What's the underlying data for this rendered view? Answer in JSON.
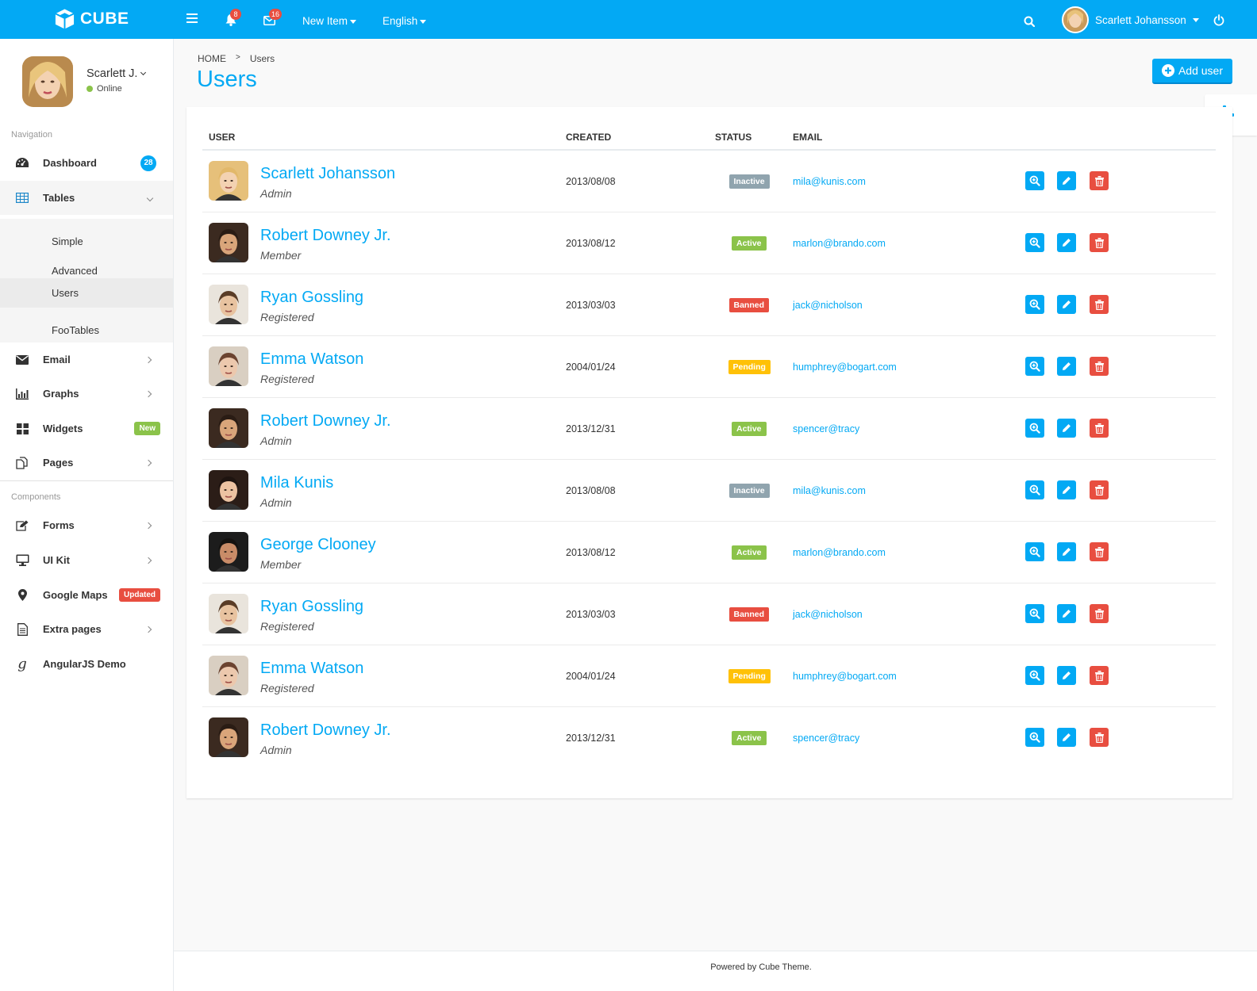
{
  "brand": "CUBE",
  "topbar": {
    "notifications_count": "8",
    "messages_count": "16",
    "new_item": "New Item",
    "language": "English",
    "user_name": "Scarlett Johansson"
  },
  "profile": {
    "name": "Scarlett J.",
    "status": "Online"
  },
  "nav": {
    "heading": "Navigation",
    "dashboard": {
      "label": "Dashboard",
      "badge": "28"
    },
    "tables": {
      "label": "Tables"
    },
    "submenu": [
      "Simple",
      "Advanced",
      "Users",
      "FooTables"
    ],
    "email": {
      "label": "Email"
    },
    "graphs": {
      "label": "Graphs"
    },
    "widgets": {
      "label": "Widgets",
      "badge": "New"
    },
    "pages": {
      "label": "Pages"
    },
    "components_heading": "Components",
    "forms": {
      "label": "Forms"
    },
    "uikit": {
      "label": "UI Kit"
    },
    "maps": {
      "label": "Google Maps",
      "badge": "Updated"
    },
    "extra": {
      "label": "Extra pages"
    },
    "angular": {
      "label": "AngularJS Demo"
    }
  },
  "breadcrumb": {
    "home": "HOME",
    "current": "Users"
  },
  "page_title": "Users",
  "add_user_label": "Add user",
  "table": {
    "headers": {
      "user": "USER",
      "created": "CREATED",
      "status": "STATUS",
      "email": "EMAIL"
    },
    "rows": [
      {
        "name": "Scarlett Johansson",
        "role": "Admin",
        "created": "2013/08/08",
        "status": "Inactive",
        "email": "mila@kunis.com"
      },
      {
        "name": "Robert Downey Jr.",
        "role": "Member",
        "created": "2013/08/12",
        "status": "Active",
        "email": "marlon@brando.com"
      },
      {
        "name": "Ryan Gossling",
        "role": "Registered",
        "created": "2013/03/03",
        "status": "Banned",
        "email": "jack@nicholson"
      },
      {
        "name": "Emma Watson",
        "role": "Registered",
        "created": "2004/01/24",
        "status": "Pending",
        "email": "humphrey@bogart.com"
      },
      {
        "name": "Robert Downey Jr.",
        "role": "Admin",
        "created": "2013/12/31",
        "status": "Active",
        "email": "spencer@tracy"
      },
      {
        "name": "Mila Kunis",
        "role": "Admin",
        "created": "2013/08/08",
        "status": "Inactive",
        "email": "mila@kunis.com"
      },
      {
        "name": "George Clooney",
        "role": "Member",
        "created": "2013/08/12",
        "status": "Active",
        "email": "marlon@brando.com"
      },
      {
        "name": "Ryan Gossling",
        "role": "Registered",
        "created": "2013/03/03",
        "status": "Banned",
        "email": "jack@nicholson"
      },
      {
        "name": "Emma Watson",
        "role": "Registered",
        "created": "2004/01/24",
        "status": "Pending",
        "email": "humphrey@bogart.com"
      },
      {
        "name": "Robert Downey Jr.",
        "role": "Admin",
        "created": "2013/12/31",
        "status": "Active",
        "email": "spencer@tracy"
      }
    ]
  },
  "status_colors": {
    "Inactive": "#90a4ae",
    "Active": "#8bc34a",
    "Banned": "#e84e40",
    "Pending": "#ffc107"
  },
  "colors": {
    "accent": "#03a9f4",
    "danger": "#e84e40",
    "success": "#8bc34a"
  },
  "icons": {
    "brand": "cube-icon",
    "menu": "hamburger-icon",
    "bell": "bell-icon",
    "mail": "envelope-icon",
    "search": "search-icon",
    "power": "power-icon",
    "settings": "gear-icon",
    "view": "zoom-in-icon",
    "edit": "pencil-icon",
    "delete": "trash-icon"
  },
  "footer": "Powered by Cube Theme."
}
